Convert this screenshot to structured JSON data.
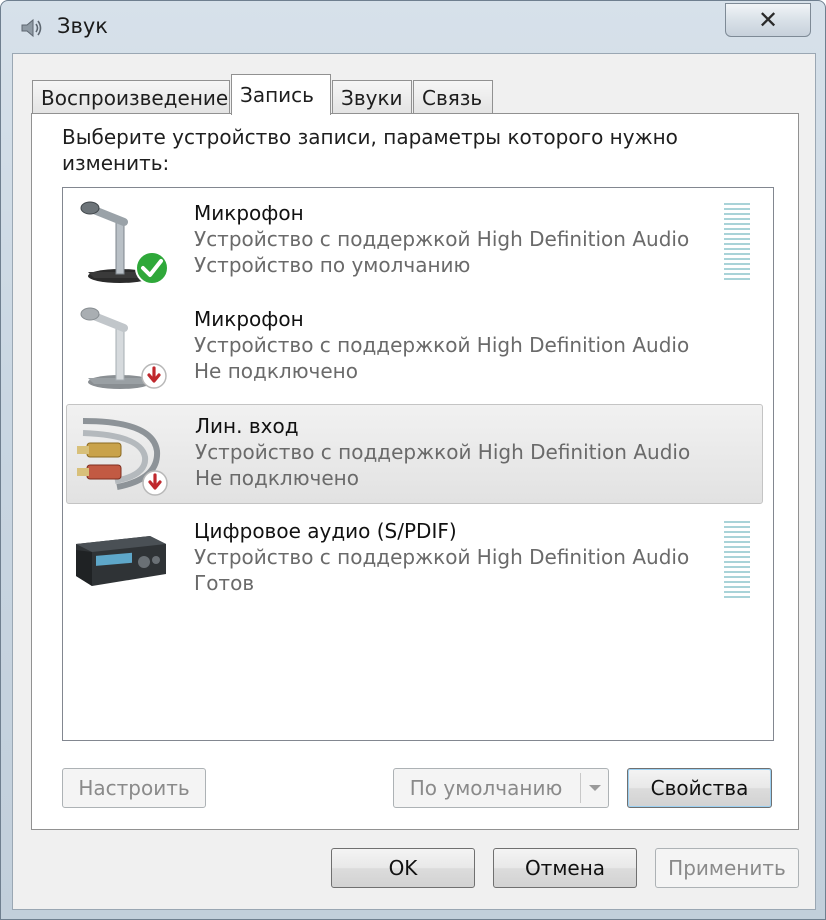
{
  "window": {
    "title": "Звук",
    "close_glyph": "✕",
    "app_icon": "speaker-icon"
  },
  "tabs": [
    {
      "label": "Воспроизведение",
      "active": false
    },
    {
      "label": "Запись",
      "active": true
    },
    {
      "label": "Звуки",
      "active": false
    },
    {
      "label": "Связь",
      "active": false
    }
  ],
  "recording": {
    "prompt": "Выберите устройство записи, параметры которого нужно изменить:",
    "devices": [
      {
        "name": "Микрофон",
        "description": "Устройство с поддержкой High Definition Audio",
        "status": "Устройство по умолчанию",
        "icon": "microphone-icon",
        "badge": "default-check-badge",
        "selected": false
      },
      {
        "name": "Микрофон",
        "description": "Устройство с поддержкой High Definition Audio",
        "status": "Не подключено",
        "icon": "microphone-icon",
        "badge": "unplugged-arrow-badge",
        "selected": false
      },
      {
        "name": "Лин. вход",
        "description": "Устройство с поддержкой High Definition Audio",
        "status": "Не подключено",
        "icon": "line-in-cable-icon",
        "badge": "unplugged-arrow-badge",
        "selected": true
      },
      {
        "name": "Цифровое аудио (S/PDIF)",
        "description": "Устройство с поддержкой High Definition Audio",
        "status": "Готов",
        "icon": "digital-receiver-icon",
        "badge": "",
        "selected": false
      }
    ]
  },
  "buttons": {
    "configure": "Настроить",
    "set_default": "По умолчанию",
    "properties": "Свойства",
    "ok": "OK",
    "cancel": "Отмена",
    "apply": "Применить"
  },
  "colors": {
    "default_check": "#2fa83a",
    "unplugged_badge": "#c0282d",
    "level_meter": "#a9d3d8"
  }
}
